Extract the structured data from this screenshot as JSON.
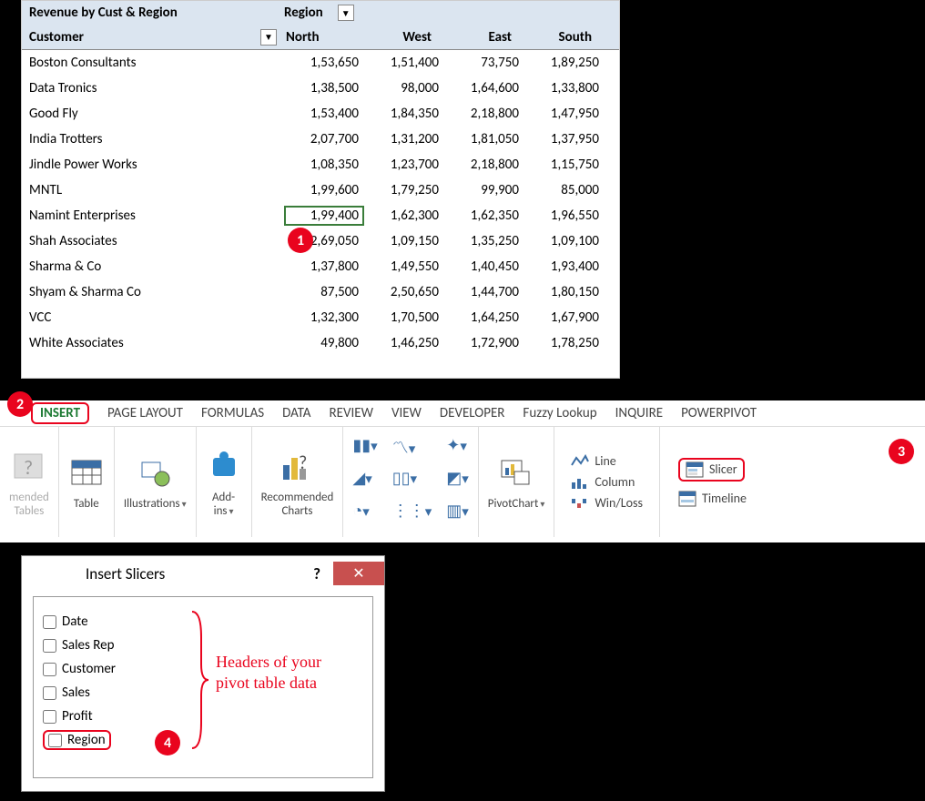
{
  "pivot": {
    "title": "Revenue by Cust & Region",
    "region_label": "Region",
    "customer_label": "Customer",
    "columns": [
      "North",
      "West",
      "East",
      "South"
    ],
    "rows": [
      {
        "name": "Boston Consultants",
        "vals": [
          "1,53,650",
          "1,51,400",
          "73,750",
          "1,89,250"
        ]
      },
      {
        "name": "Data Tronics",
        "vals": [
          "1,38,500",
          "98,000",
          "1,64,600",
          "1,33,800"
        ]
      },
      {
        "name": "Good Fly",
        "vals": [
          "1,53,400",
          "1,84,350",
          "2,18,800",
          "1,47,950"
        ]
      },
      {
        "name": "India Trotters",
        "vals": [
          "2,07,700",
          "1,31,200",
          "1,81,050",
          "1,37,950"
        ]
      },
      {
        "name": "Jindle Power Works",
        "vals": [
          "1,08,350",
          "1,23,700",
          "2,18,800",
          "1,15,750"
        ]
      },
      {
        "name": "MNTL",
        "vals": [
          "1,99,600",
          "1,79,250",
          "99,900",
          "85,000"
        ]
      },
      {
        "name": "Namint Enterprises",
        "vals": [
          "1,99,400",
          "1,62,300",
          "1,62,350",
          "1,96,550"
        ]
      },
      {
        "name": "Shah Associates",
        "vals": [
          "2,69,050",
          "1,09,150",
          "1,35,250",
          "1,09,100"
        ]
      },
      {
        "name": "Sharma & Co",
        "vals": [
          "1,37,800",
          "1,49,550",
          "1,40,450",
          "1,93,400"
        ]
      },
      {
        "name": "Shyam & Sharma Co",
        "vals": [
          "87,500",
          "2,50,650",
          "1,44,700",
          "1,80,150"
        ]
      },
      {
        "name": "VCC",
        "vals": [
          "1,32,300",
          "1,70,500",
          "1,64,250",
          "1,67,900"
        ]
      },
      {
        "name": "White Associates",
        "vals": [
          "49,800",
          "1,46,250",
          "1,72,900",
          "1,78,250"
        ]
      }
    ],
    "selected": {
      "row": 6,
      "col": 0
    }
  },
  "ribbon": {
    "tabs": [
      "INSERT",
      "PAGE LAYOUT",
      "FORMULAS",
      "DATA",
      "REVIEW",
      "VIEW",
      "DEVELOPER",
      "Fuzzy Lookup",
      "INQUIRE",
      "POWERPIVOT"
    ],
    "active_tab": "INSERT",
    "groups": {
      "rec_tables": "mended\nTables",
      "table": "Table",
      "illustrations": "Illustrations",
      "addins": "Add-\nins",
      "rec_charts": "Recommended\nCharts",
      "pivotchart": "PivotChart",
      "line": "Line",
      "column": "Column",
      "winloss": "Win/Loss",
      "slicer": "Slicer",
      "timeline": "Timeline"
    }
  },
  "dialog": {
    "title": "Insert Slicers",
    "fields": [
      "Date",
      "Sales Rep",
      "Customer",
      "Sales",
      "Profit",
      "Region"
    ],
    "annotation": "Headers of your\npivot table data"
  },
  "callouts": {
    "c1": "1",
    "c2": "2",
    "c3": "3",
    "c4": "4"
  }
}
